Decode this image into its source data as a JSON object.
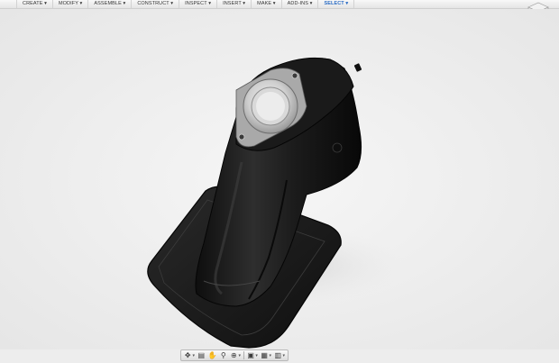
{
  "toolbar": {
    "menus": [
      {
        "label": "CREATE ▾"
      },
      {
        "label": "MODIFY ▾"
      },
      {
        "label": "ASSEMBLE ▾"
      },
      {
        "label": "CONSTRUCT ▾"
      },
      {
        "label": "INSPECT ▾"
      },
      {
        "label": "INSERT ▾"
      },
      {
        "label": "MAKE ▾"
      },
      {
        "label": "ADD-INS ▾"
      },
      {
        "label": "SELECT ▾"
      }
    ]
  },
  "navigation_bar": {
    "icons": [
      "orbit-icon",
      "look-at-icon",
      "pan-icon",
      "zoom-icon",
      "fit-icon",
      "display-settings-icon",
      "grid-settings-icon",
      "viewport-icon"
    ]
  },
  "colors": {
    "accent": "#2b6cc4",
    "background": "#ededed",
    "model": "#1c1c1c"
  }
}
